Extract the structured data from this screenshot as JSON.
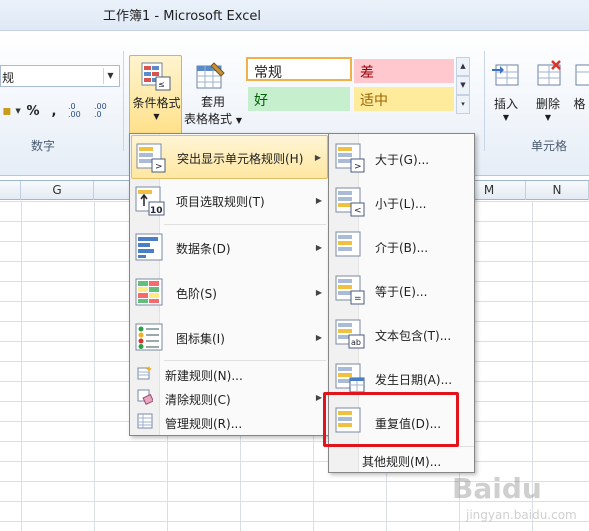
{
  "window": {
    "title": "工作簿1 - Microsoft Excel"
  },
  "ribbon": {
    "number_format_value": "规",
    "number_buttons": {
      "percent": "%",
      "comma": ",",
      "inc_decimal": ".0 .00",
      "dec_decimal": ".00 .0"
    },
    "number_group_label": "数字",
    "conditional_format_label": "条件格式",
    "table_format_label_1": "套用",
    "table_format_label_2": "表格格式",
    "styles": {
      "normal": "常规",
      "bad": "差",
      "good": "好",
      "neutral": "适中"
    },
    "insert_label": "插入",
    "delete_label": "删除",
    "format_label": "格",
    "cells_group_label": "单元格"
  },
  "sheet": {
    "columns": [
      "G",
      "N"
    ],
    "column_m": "M"
  },
  "conditional_menu": {
    "items": [
      {
        "label": "突出显示单元格规则(H)",
        "icon": "highlight-cells-icon",
        "has_submenu": true
      },
      {
        "label": "项目选取规则(T)",
        "icon": "top-bottom-icon",
        "has_submenu": true
      },
      {
        "label": "数据条(D)",
        "icon": "data-bars-icon",
        "has_submenu": true
      },
      {
        "label": "色阶(S)",
        "icon": "color-scales-icon",
        "has_submenu": true
      },
      {
        "label": "图标集(I)",
        "icon": "icon-sets-icon",
        "has_submenu": true
      }
    ],
    "small_items": [
      {
        "label": "新建规则(N)...",
        "icon": "new-rule-icon"
      },
      {
        "label": "清除规则(C)",
        "icon": "clear-rules-icon"
      },
      {
        "label": "管理规则(R)...",
        "icon": "manage-rules-icon"
      }
    ]
  },
  "highlight_submenu": {
    "items": [
      {
        "label": "大于(G)...",
        "icon": "greater-than-icon"
      },
      {
        "label": "小于(L)...",
        "icon": "less-than-icon"
      },
      {
        "label": "介于(B)...",
        "icon": "between-icon"
      },
      {
        "label": "等于(E)...",
        "icon": "equal-to-icon"
      },
      {
        "label": "文本包含(T)...",
        "icon": "text-contains-icon"
      },
      {
        "label": "发生日期(A)...",
        "icon": "date-occurring-icon"
      },
      {
        "label": "重复值(D)...",
        "icon": "duplicate-values-icon"
      }
    ],
    "more_rules": "其他规则(M)..."
  },
  "watermark": {
    "brand": "Baidu",
    "sub": "jingyan.baidu.com"
  },
  "colors": {
    "highlight": "#ffe7a2",
    "callout": "#e1141c",
    "ribbon_border": "#b7c7da"
  }
}
